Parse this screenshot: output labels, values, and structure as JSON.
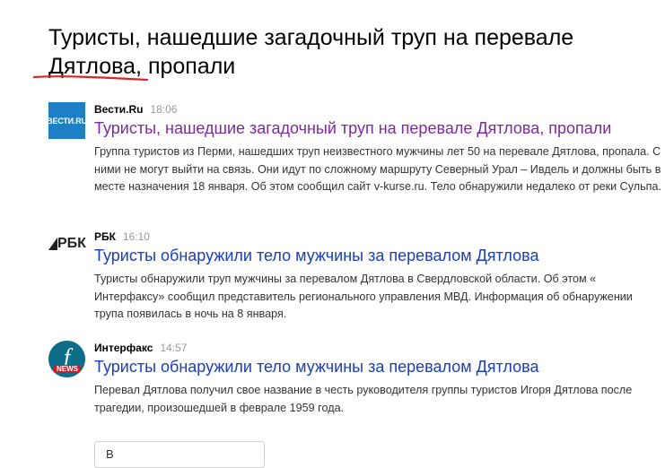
{
  "headline": "Туристы, нашедшие загадочный труп на перевале Дятлова, пропали",
  "colors": {
    "link": "#1a3dc1",
    "visited": "#7b2aa1",
    "underline": "#d9262b"
  },
  "items": [
    {
      "source": "Вести.Ru",
      "time": "18:06",
      "logo_text": "ВЕСТИ.RU",
      "title": "Туристы, нашедшие загадочный труп на перевале Дятлова, пропали",
      "snippet": "Группа туристов из Перми, нашедших труп неизвестного мужчины лет 50 на перевале Дятлова, пропала. С ними не могут выйти на связь. Они идут по сложному маршруту Северный Урал – Ивдель и должны быть в месте назначения 18 января. Об этом сообщил сайт v-kurse.ru. Тело обнаружили недалеко от реки Сульпа."
    },
    {
      "source": "РБК",
      "time": "16:10",
      "logo_text": "РБК",
      "title": "Туристы обнаружили тело мужчины за перевалом Дятлова",
      "snippet": "Туристы обнаружили труп мужчины за перевалом Дятлова в Свердловской области. Об этом « Интерфаксу» сообщил представитель регионального управления МВД. Информация об обнаружении трупа появилась в ночь на 8 января."
    },
    {
      "source": "Интерфакс",
      "time": "14:57",
      "logo_text": "NEWS",
      "title": "Туристы обнаружили тело мужчины за перевалом Дятлова",
      "snippet": "Перевал Дятлова получил свое название в честь руководителя группы туристов Игоря Дятлова после трагедии, произошедшей в феврале 1959 года."
    }
  ],
  "more_button": "В"
}
